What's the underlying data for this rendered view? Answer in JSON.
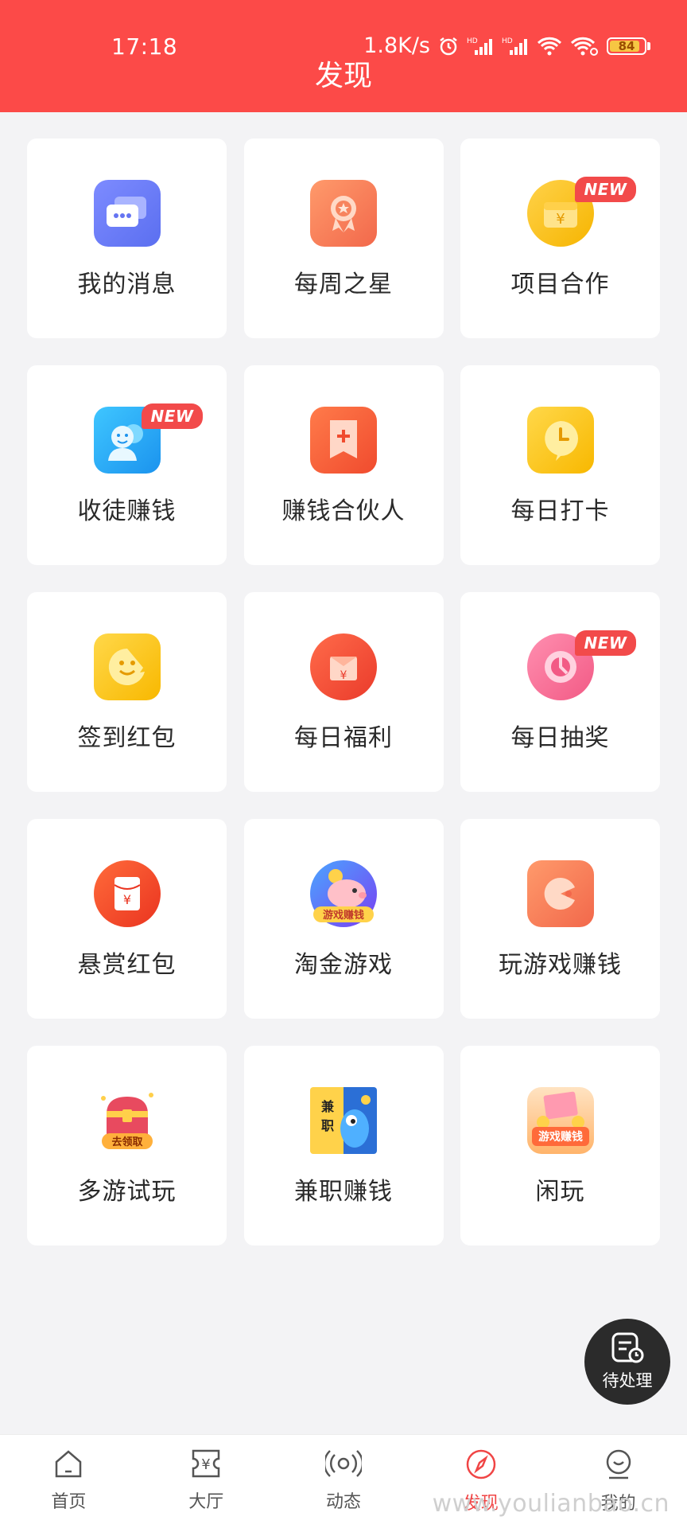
{
  "status_bar": {
    "time": "17:18",
    "net_speed": "1.8K/s",
    "battery": "84",
    "battery_level": 0.84,
    "signal_label_1": "HD",
    "signal_label_2": "HD"
  },
  "header": {
    "title": "发现",
    "background": "#fc4a48"
  },
  "grid": [
    {
      "label": "我的消息",
      "icon": "chat-bubbles-icon",
      "new": false
    },
    {
      "label": "每周之星",
      "icon": "medal-icon",
      "new": false
    },
    {
      "label": "项目合作",
      "icon": "cooperation-icon",
      "new": true
    },
    {
      "label": "收徒赚钱",
      "icon": "recruit-icon",
      "new": true
    },
    {
      "label": "赚钱合伙人",
      "icon": "partner-icon",
      "new": false
    },
    {
      "label": "每日打卡",
      "icon": "clock-icon",
      "new": false
    },
    {
      "label": "签到红包",
      "icon": "smile-icon",
      "new": false
    },
    {
      "label": "每日福利",
      "icon": "gift-envelope-icon",
      "new": false
    },
    {
      "label": "每日抽奖",
      "icon": "lottery-icon",
      "new": true
    },
    {
      "label": "悬赏红包",
      "icon": "red-envelope-icon",
      "new": false
    },
    {
      "label": "淘金游戏",
      "icon": "gold-pig-icon",
      "new": false,
      "icon_text": "游戏赚钱"
    },
    {
      "label": "玩游戏赚钱",
      "icon": "game-pacman-icon",
      "new": false
    },
    {
      "label": "多游试玩",
      "icon": "treasure-chest-icon",
      "new": false,
      "icon_text": "去领取"
    },
    {
      "label": "兼职赚钱",
      "icon": "parttime-icon",
      "new": false,
      "icon_text": "兼职"
    },
    {
      "label": "闲玩",
      "icon": "coins-icon",
      "new": false,
      "icon_text": "游戏赚钱"
    }
  ],
  "new_badge": "NEW",
  "pending_button": {
    "label": "待处理"
  },
  "bottom_nav": [
    {
      "label": "首页",
      "icon": "home-icon",
      "active": false
    },
    {
      "label": "大厅",
      "icon": "hall-icon",
      "active": false
    },
    {
      "label": "动态",
      "icon": "broadcast-icon",
      "active": false
    },
    {
      "label": "发现",
      "icon": "compass-icon",
      "active": true
    },
    {
      "label": "我的",
      "icon": "user-icon",
      "active": false
    }
  ],
  "watermark": "www.youlianbao.cn",
  "colors": {
    "accent": "#f04545",
    "header": "#fc4a48",
    "background": "#f3f3f5"
  }
}
